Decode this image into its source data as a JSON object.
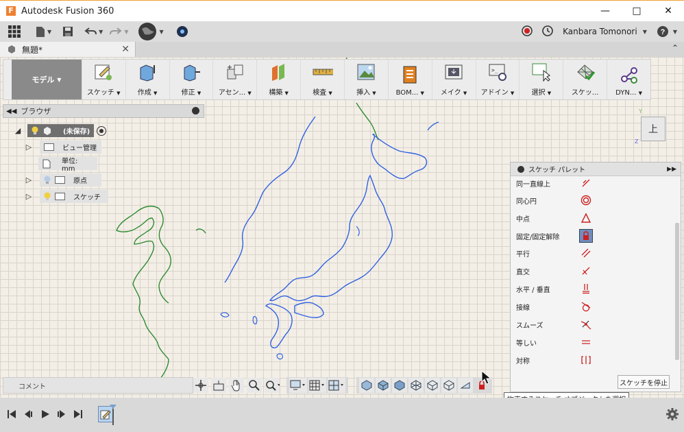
{
  "window": {
    "title": "Autodesk Fusion 360",
    "logo_letter": "F"
  },
  "qat": {
    "user_name": "Kanbara Tomonori"
  },
  "tab": {
    "title": "無題*"
  },
  "toolbar": {
    "workspace": "モデル",
    "tools": [
      {
        "label": "スケッチ",
        "icon": "sketch-icon"
      },
      {
        "label": "作成",
        "icon": "create-icon"
      },
      {
        "label": "修正",
        "icon": "modify-icon"
      },
      {
        "label": "アセン...",
        "icon": "assemble-icon"
      },
      {
        "label": "構築",
        "icon": "construct-icon"
      },
      {
        "label": "検査",
        "icon": "inspect-icon"
      },
      {
        "label": "挿入",
        "icon": "insert-icon"
      },
      {
        "label": "BOM...",
        "icon": "bom-icon"
      },
      {
        "label": "メイク",
        "icon": "make-icon"
      },
      {
        "label": "アドイン",
        "icon": "addin-icon"
      },
      {
        "label": "選択",
        "icon": "select-icon"
      },
      {
        "label": "スケッ...",
        "icon": "sketch-check-icon"
      },
      {
        "label": "DYN...",
        "icon": "dynamo-icon"
      }
    ]
  },
  "browser": {
    "title": "ブラウザ",
    "root": "(未保存)",
    "items": [
      {
        "label": "ビュー管理"
      },
      {
        "label": "単位: mm"
      },
      {
        "label": "原点"
      },
      {
        "label": "スケッチ"
      }
    ]
  },
  "viewcube": {
    "face": "上"
  },
  "palette": {
    "title": "スケッチ パレット",
    "items": [
      {
        "label": "同一直線上",
        "icon": "collinear-icon"
      },
      {
        "label": "同心円",
        "icon": "concentric-icon"
      },
      {
        "label": "中点",
        "icon": "midpoint-icon"
      },
      {
        "label": "固定/固定解除",
        "icon": "lock-icon"
      },
      {
        "label": "平行",
        "icon": "parallel-icon"
      },
      {
        "label": "直交",
        "icon": "perpendicular-icon"
      },
      {
        "label": "水平 / 垂直",
        "icon": "horizontal-vertical-icon"
      },
      {
        "label": "接線",
        "icon": "tangent-icon"
      },
      {
        "label": "スムーズ",
        "icon": "smooth-icon"
      },
      {
        "label": "等しい",
        "icon": "equal-icon"
      },
      {
        "label": "対称",
        "icon": "symmetric-icon"
      }
    ],
    "stop_label": "スケッチを停止"
  },
  "bottom": {
    "comment": "コメント",
    "tooltip": "拘束するスケッチ オブジェクトを選択"
  },
  "colors": {
    "accent": "#f08030",
    "japan_outline": "#3060e0",
    "mainland_outline": "#2f8a2f",
    "constraint_red": "#cc2020"
  }
}
